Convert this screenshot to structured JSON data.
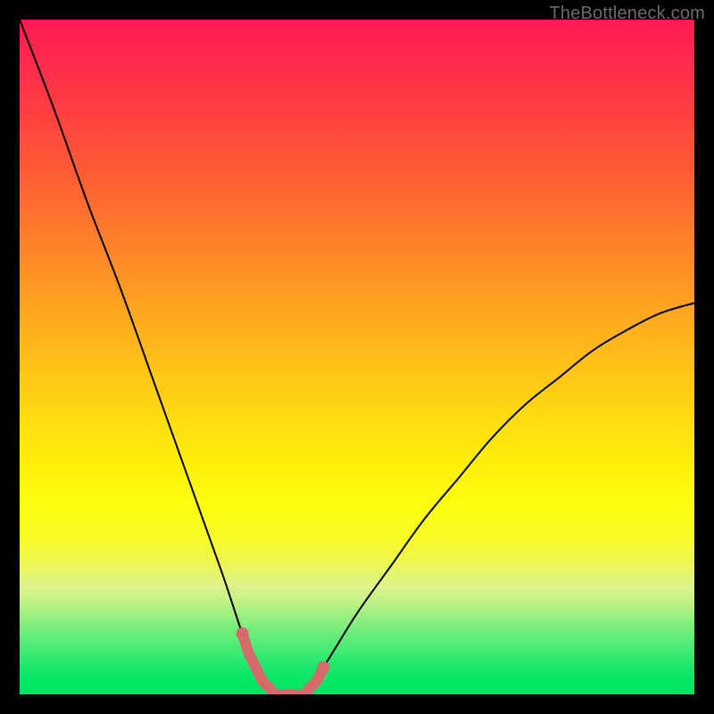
{
  "watermark": "TheBottleneck.com",
  "colors": {
    "frame_border": "#000000",
    "curve_stroke": "#000000",
    "valley_stroke": "#d56a6a"
  },
  "chart_data": {
    "type": "line",
    "title": "",
    "xlabel": "",
    "ylabel": "",
    "xlim": [
      0,
      100
    ],
    "ylim": [
      0,
      100
    ],
    "series": [
      {
        "name": "bottleneck-curve",
        "x": [
          0,
          5,
          10,
          15,
          20,
          25,
          30,
          33,
          35,
          38,
          40,
          42,
          45,
          50,
          55,
          60,
          65,
          70,
          75,
          80,
          85,
          90,
          95,
          100
        ],
        "y": [
          100,
          87,
          73,
          60,
          46,
          32,
          18,
          9,
          4,
          0,
          0,
          0,
          4,
          12,
          19,
          26,
          32,
          38,
          43,
          47,
          51,
          54,
          56.5,
          58
        ]
      }
    ],
    "valley_segment": {
      "name": "optimal-range",
      "x_start": 33,
      "x_end": 45,
      "points": [
        {
          "x": 33.0,
          "y": 9.0
        },
        {
          "x": 34.0,
          "y": 6.0
        },
        {
          "x": 35.0,
          "y": 4.0
        },
        {
          "x": 36.0,
          "y": 2.0
        },
        {
          "x": 37.0,
          "y": 1.0
        },
        {
          "x": 38.0,
          "y": 0.0
        },
        {
          "x": 40.0,
          "y": 0.0
        },
        {
          "x": 42.0,
          "y": 0.0
        },
        {
          "x": 43.0,
          "y": 1.0
        },
        {
          "x": 44.0,
          "y": 2.0
        },
        {
          "x": 45.0,
          "y": 4.0
        }
      ]
    }
  }
}
